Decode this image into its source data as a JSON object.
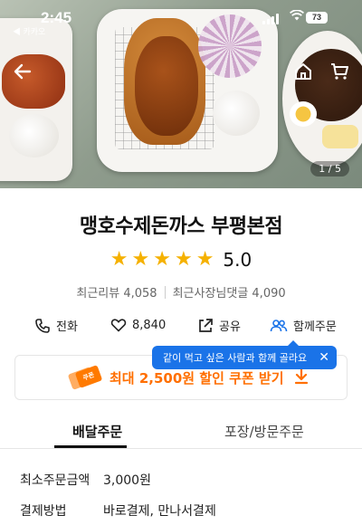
{
  "status_bar": {
    "time": "2:45",
    "carrier": "◀ 카카오",
    "battery": "73"
  },
  "hero": {
    "page_indicator": "1 / 5"
  },
  "store": {
    "name": "맹호수제돈까스 부평본점",
    "rating": 5.0,
    "rating_text": "5.0",
    "stars": 5,
    "recent_reviews": "최근리뷰 4,058",
    "owner_replies": "최근사장님댓글 4,090"
  },
  "actions": {
    "call": "전화",
    "likes": "8,840",
    "share": "공유",
    "group_order": "함께주문"
  },
  "tooltip": {
    "text": "같이 먹고 싶은 사람과 함께 골라요",
    "close": "✕"
  },
  "coupon": {
    "icon_text": "쿠폰",
    "text": "최대 2,500원 할인 쿠폰 받기"
  },
  "tabs": {
    "delivery": "배달주문",
    "pickup": "포장/방문주문",
    "active": "배달주문"
  },
  "order_info": {
    "min_order_label": "최소주문금액",
    "min_order_value": "3,000원",
    "payment_label": "결제방법",
    "payment_value": "바로결제, 만나서결제"
  },
  "colors": {
    "star": "#f5b100",
    "tooltip_bg": "#1a73e8",
    "coupon_accent": "#ff6f00",
    "group_icon": "#1a73e8"
  },
  "icons": {
    "back": "arrow-left-icon",
    "home": "home-icon",
    "cart": "cart-icon",
    "call": "phone-icon",
    "like": "heart-icon",
    "share": "share-icon",
    "group": "people-icon",
    "coupon_download": "download-arrow-icon"
  }
}
